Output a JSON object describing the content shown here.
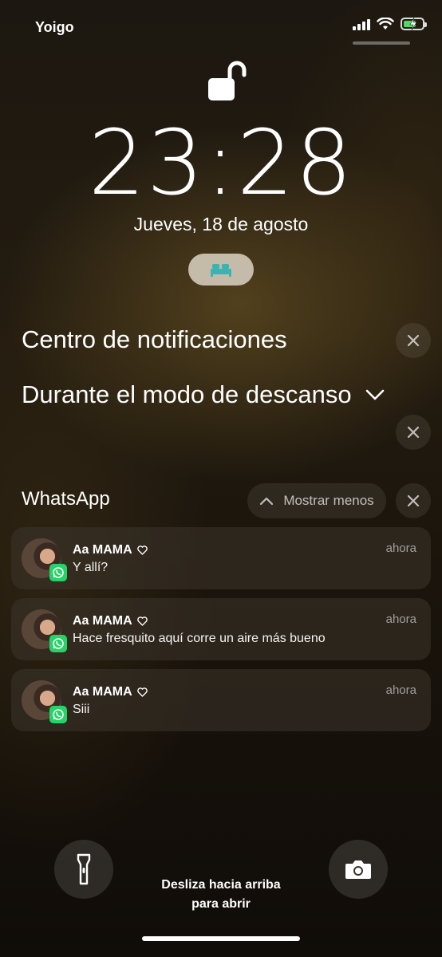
{
  "status_bar": {
    "carrier": "Yoigo"
  },
  "lock_screen": {
    "time": "23:28",
    "date": "Jueves, 18 de agosto"
  },
  "notification_center": {
    "title": "Centro de notificaciones",
    "rest_mode_label": "Durante el modo de descanso"
  },
  "whatsapp_group": {
    "app_name": "WhatsApp",
    "show_less_label": "Mostrar menos",
    "notifications": [
      {
        "sender": "Aa MAMA",
        "message": "Y allí?",
        "time": "ahora"
      },
      {
        "sender": "Aa MAMA",
        "message": "Hace fresquito aquí corre un aire más bueno",
        "time": "ahora"
      },
      {
        "sender": "Aa MAMA",
        "message": "Siii",
        "time": "ahora"
      }
    ]
  },
  "bottom": {
    "swipe_hint_line1": "Desliza hacia arriba",
    "swipe_hint_line2": "para abrir"
  },
  "icons": [
    "unlock-icon",
    "bed-icon",
    "close-icon",
    "chevron-down-icon",
    "chevron-up-icon",
    "whatsapp-icon",
    "heart-icon",
    "flashlight-icon",
    "camera-icon"
  ],
  "colors": {
    "whatsapp_green": "#25d366",
    "bed_icon": "#3bb3b0",
    "battery_green": "#4cd964"
  }
}
